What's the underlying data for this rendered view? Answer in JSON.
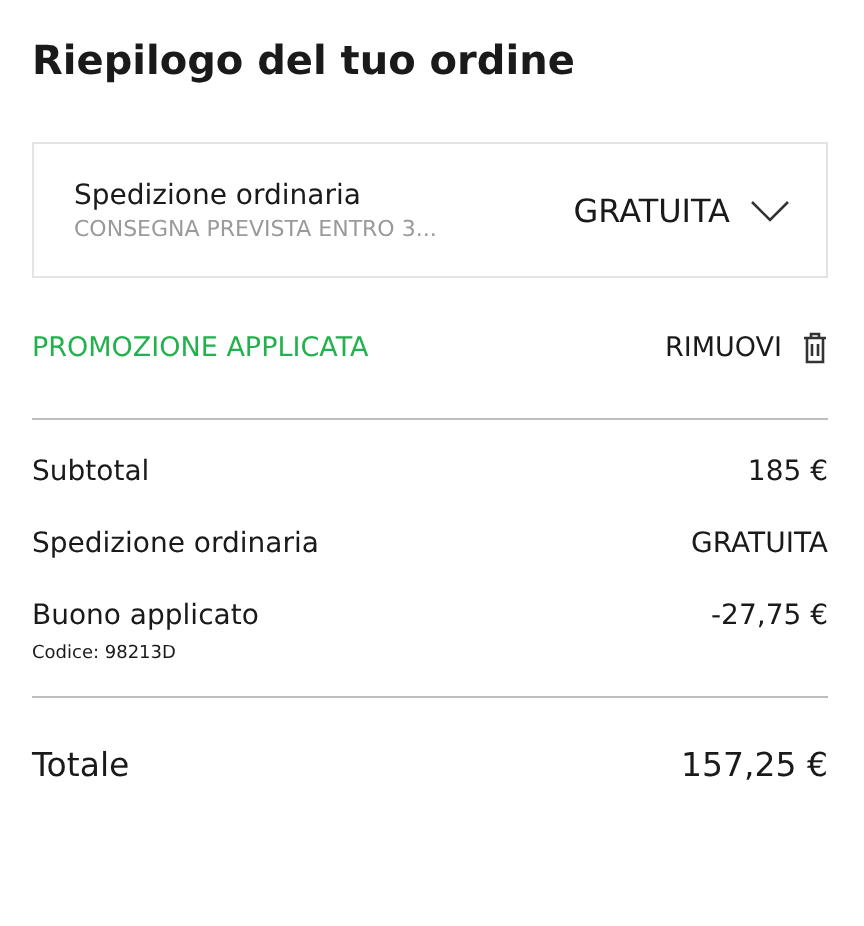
{
  "title": "Riepilogo del tuo ordine",
  "shipping_select": {
    "label": "Spedizione ordinaria",
    "note": "CONSEGNA PREVISTA ENTRO 3...",
    "value": "GRATUITA",
    "expanded": false
  },
  "promotion": {
    "status": "PROMOZIONE APPLICATA",
    "remove": "RIMUOVI"
  },
  "lines": [
    {
      "label": "Subtotal",
      "amount": "185 €"
    },
    {
      "label": "Spedizione ordinaria",
      "amount": "GRATUITA"
    },
    {
      "label": "Buono applicato",
      "amount": "-27,75 €",
      "code": "Codice: 98213D"
    }
  ],
  "total": {
    "label": "Totale",
    "amount": "157,25 €"
  }
}
